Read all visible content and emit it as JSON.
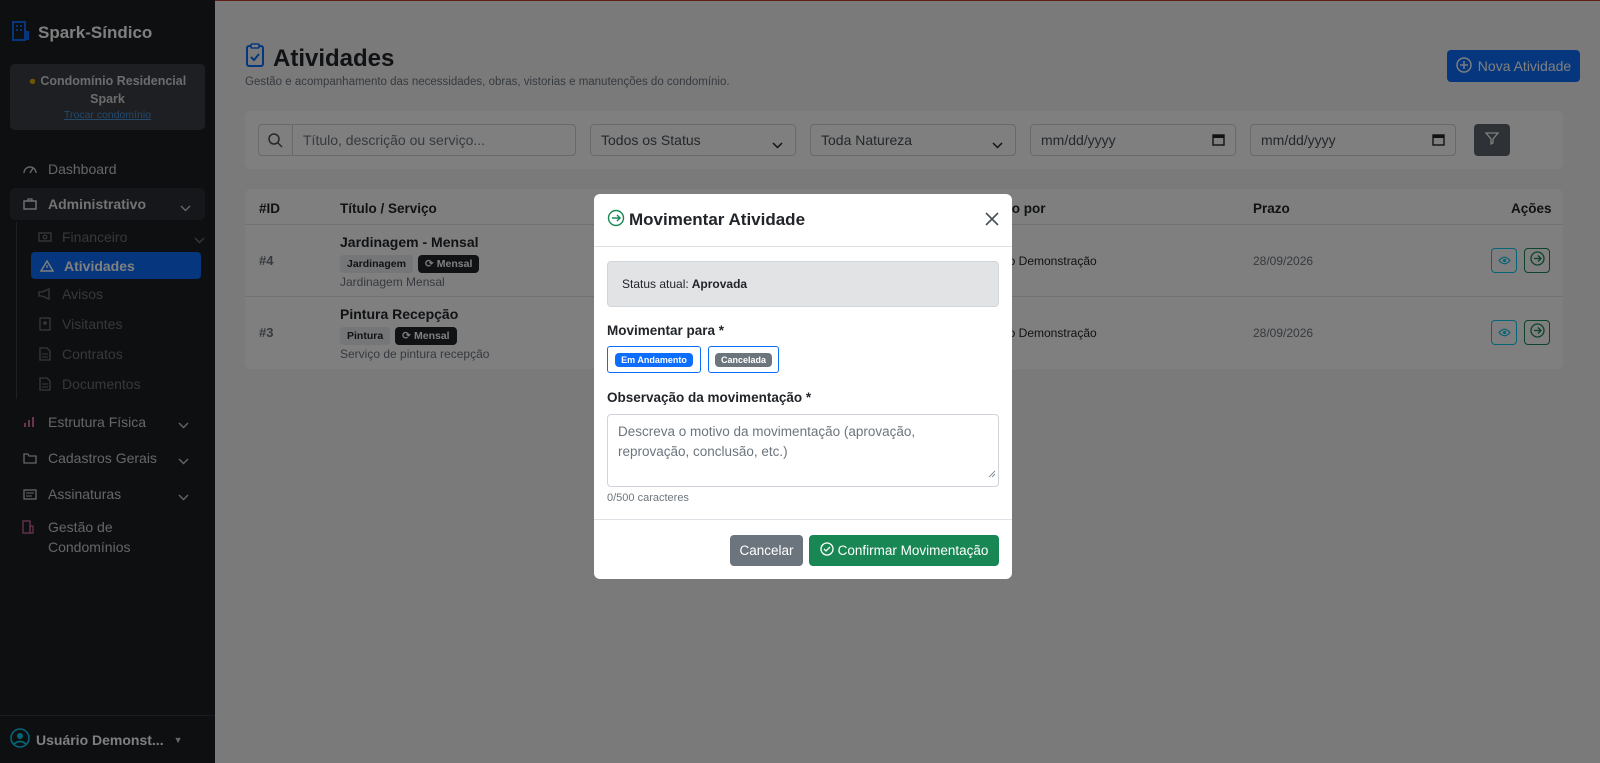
{
  "app": {
    "brand": "Spark-Síndico"
  },
  "condo": {
    "name": "Condomínio Residencial Spark",
    "switch_link": "Trocar condomínio"
  },
  "sidebar": {
    "dashboard": "Dashboard",
    "administrativo": "Administrativo",
    "sub": {
      "financeiro": "Financeiro",
      "atividades": "Atividades",
      "avisos": "Avisos",
      "visitantes": "Visitantes",
      "contratos": "Contratos",
      "documentos": "Documentos"
    },
    "estrutura": "Estrutura Física",
    "cadastros": "Cadastros Gerais",
    "assinaturas": "Assinaturas",
    "gestao": "Gestão de Condomínios",
    "user": "Usuário Demonst..."
  },
  "page": {
    "title": "Atividades",
    "subtitle": "Gestão e acompanhamento das necessidades, obras, vistorias e manutenções do condomínio.",
    "new_button": "Nova Atividade"
  },
  "filters": {
    "search_placeholder": "Título, descrição ou serviço...",
    "status": "Todos os Status",
    "natureza": "Toda Natureza",
    "date_from": "mm/dd/yyyy",
    "date_to": "mm/dd/yyyy"
  },
  "table": {
    "headers": {
      "id": "#ID",
      "titulo": "Título / Serviço",
      "autor": "rto por",
      "prazo": "Prazo",
      "acoes": "Ações"
    },
    "rows": [
      {
        "id": "#4",
        "title": "Jardinagem - Mensal",
        "tag": "Jardinagem",
        "freq": "Mensal",
        "desc": "Jardinagem Mensal",
        "autor": "rio Demonstração",
        "prazo": "28/09/2026"
      },
      {
        "id": "#3",
        "title": "Pintura Recepção",
        "tag": "Pintura",
        "freq": "Mensal",
        "desc": "Serviço de pintura recepção",
        "autor": "rio Demonstração",
        "prazo": "28/09/2026"
      }
    ]
  },
  "modal": {
    "title": "Movimentar Atividade",
    "status_label": "Status atual:",
    "status_value": "Aprovada",
    "move_to_label": "Movimentar para *",
    "options": [
      "Em Andamento",
      "Cancelada"
    ],
    "obs_label": "Observação da movimentação *",
    "obs_placeholder": "Descreva o motivo da movimentação (aprovação, reprovação, conclusão, etc.)",
    "counter": "0/500 caracteres",
    "cancel": "Cancelar",
    "confirm": "Confirmar Movimentação"
  },
  "colors": {
    "primary": "#0d6efd",
    "success": "#198754",
    "secondary": "#6c757d",
    "sidebar": "#1b1e22"
  }
}
